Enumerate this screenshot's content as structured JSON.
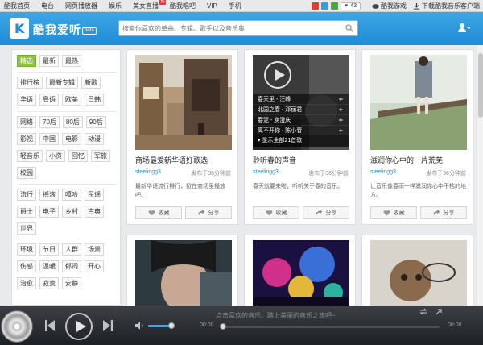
{
  "topnav": {
    "links": [
      {
        "label": "酷我首页",
        "hot": false
      },
      {
        "label": "电台",
        "hot": false
      },
      {
        "label": "网页播放器",
        "hot": false
      },
      {
        "label": "娱乐",
        "hot": false
      },
      {
        "label": "美女直播",
        "hot": true,
        "hot_text": "热"
      },
      {
        "label": "酷我唱吧",
        "hot": false
      },
      {
        "label": "VIP",
        "hot": false
      },
      {
        "label": "手机",
        "hot": false
      }
    ],
    "like_count": "43",
    "game_link": "酷我游戏",
    "download_link": "下载酷我音乐客户端"
  },
  "header": {
    "logo_text": "酷我爱听",
    "beta": "beta",
    "search_placeholder": "搜索你喜欢的单曲、专辑、歌手以及音乐集"
  },
  "sidebar": {
    "groups": [
      [
        "精选",
        "最新",
        "最热"
      ],
      [
        "排行榜",
        "最新专辑",
        "新歌",
        "华语",
        "粤语",
        "欧美",
        "日韩"
      ],
      [
        "网络",
        "70后",
        "80后",
        "90后",
        "影视",
        "中国",
        "电影",
        "动漫",
        "轻音乐",
        "小资",
        "回忆",
        "军旅",
        "校园"
      ],
      [
        "流行",
        "摇滚",
        "嘻哈",
        "民谣",
        "爵士",
        "电子",
        "乡村",
        "古典",
        "世界"
      ],
      [
        "环境",
        "节日",
        "人群",
        "场景",
        "伤感",
        "温暖",
        "郁闷",
        "开心",
        "治愈",
        "寂寞",
        "安静"
      ]
    ],
    "active": "精选"
  },
  "cards": [
    {
      "title": "商场最爱新华语好歌选",
      "user": "steelingg3",
      "time": "发布于36分钟前",
      "desc": "最新华语流行排行，掀在商场里播放吧。",
      "collect": "收藏",
      "share": "分享"
    },
    {
      "title": "聆听春的声音",
      "user": "steelingg3",
      "time": "发布于36分钟前",
      "desc": "春天就要来啦，听听关于春的音乐。",
      "collect": "收藏",
      "share": "分享",
      "playlist": [
        "春天里 - 汪峰",
        "北国之春 - 邓丽君",
        "春泥 - 庾澄庆",
        "离不开你 - 陈小春"
      ],
      "playlist_all": "显示全部21首歌"
    },
    {
      "title": "滋润你心中的一片荒芜",
      "user": "steelingg3",
      "time": "发布于36分钟前",
      "desc": "让音乐像春雨一样滋润你心中干枯的地方。",
      "collect": "收藏",
      "share": "分享"
    }
  ],
  "player": {
    "now_playing": "点击喜欢的音乐，踏上美丽的音乐之旅吧~",
    "time_current": "00:00",
    "time_total": "00:00",
    "volume": 0.85,
    "progress": 0
  }
}
